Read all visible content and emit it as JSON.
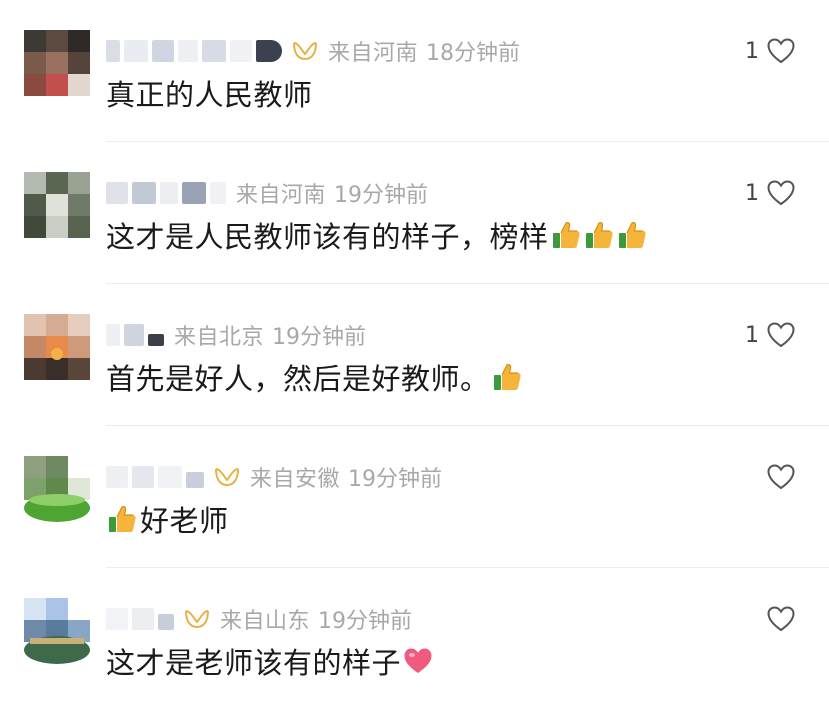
{
  "comments": [
    {
      "location": "来自河南",
      "time": "18分钟前",
      "likes": "1",
      "text": "真正的人民教师",
      "emoji_count": 0,
      "emoji_type": "",
      "emoji_first": false,
      "has_badge": true
    },
    {
      "location": "来自河南",
      "time": "19分钟前",
      "likes": "1",
      "text": "这才是人民教师该有的样子，榜样",
      "emoji_count": 3,
      "emoji_type": "thumbs-up",
      "emoji_first": false,
      "has_badge": false
    },
    {
      "location": "来自北京",
      "time": "19分钟前",
      "likes": "1",
      "text": "首先是好人，然后是好教师。",
      "emoji_count": 1,
      "emoji_type": "thumbs-up",
      "emoji_first": false,
      "has_badge": false
    },
    {
      "location": "来自安徽",
      "time": "19分钟前",
      "likes": "",
      "text": "好老师",
      "emoji_count": 1,
      "emoji_type": "thumbs-up",
      "emoji_first": true,
      "has_badge": true
    },
    {
      "location": "来自山东",
      "time": "19分钟前",
      "likes": "",
      "text": "这才是老师该有的样子",
      "emoji_count": 1,
      "emoji_type": "heart",
      "emoji_first": false,
      "has_badge": true
    }
  ],
  "icons": {
    "like": "heart-outline-icon",
    "badge": "vip-badge-icon",
    "thumbs_up": "thumbs-up-emoji",
    "heart_emoji": "red-heart-emoji"
  },
  "colors": {
    "meta_text": "#a8a8a8",
    "body_text": "#1a1a1a",
    "badge_gold": "#e7b24a",
    "divider": "#ececec",
    "heart_emoji": "#f05a7e"
  }
}
